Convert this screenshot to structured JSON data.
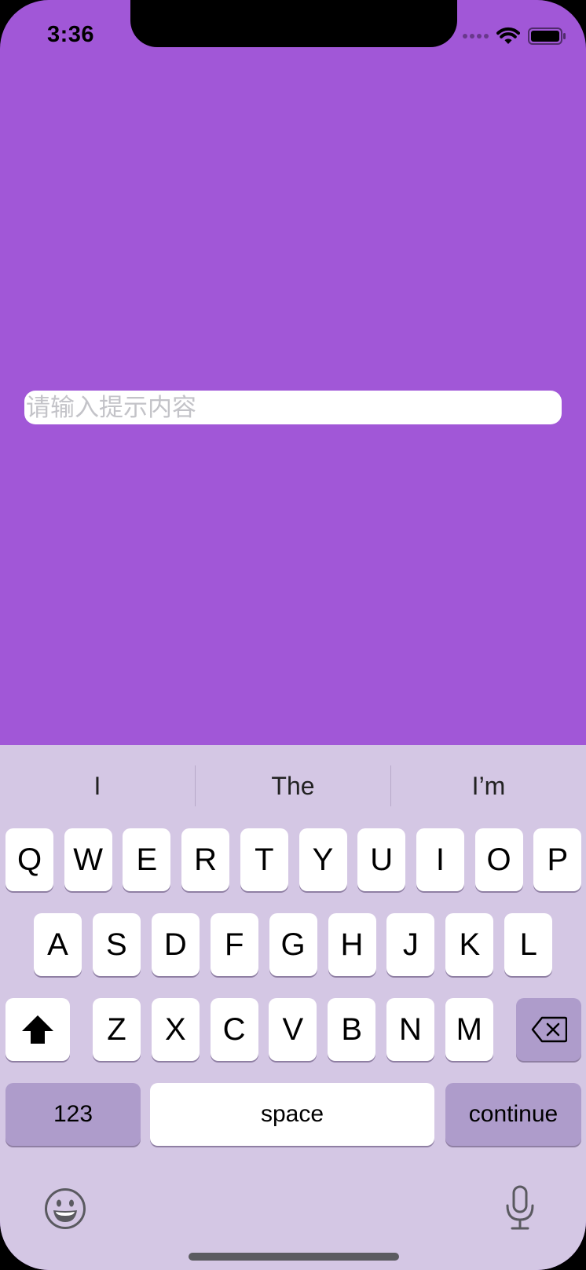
{
  "status_bar": {
    "time": "3:36",
    "icons": [
      "signal-dots-icon",
      "wifi-icon",
      "battery-icon"
    ]
  },
  "text_field": {
    "placeholder": "请输入提示内容",
    "value": ""
  },
  "keyboard": {
    "suggestions": [
      "I",
      "The",
      "I’m"
    ],
    "row1": [
      "Q",
      "W",
      "E",
      "R",
      "T",
      "Y",
      "U",
      "I",
      "O",
      "P"
    ],
    "row2": [
      "A",
      "S",
      "D",
      "F",
      "G",
      "H",
      "J",
      "K",
      "L"
    ],
    "row3": [
      "Z",
      "X",
      "C",
      "V",
      "B",
      "N",
      "M"
    ],
    "numbers_label": "123",
    "space_label": "space",
    "return_label": "continue",
    "icons": [
      "shift-icon",
      "backspace-icon",
      "emoji-icon",
      "microphone-icon"
    ]
  },
  "colors": {
    "background": "#a157d7",
    "keyboard_background": "#d4c7e4",
    "key": "#ffffff",
    "special_key": "#ae9ccb"
  }
}
